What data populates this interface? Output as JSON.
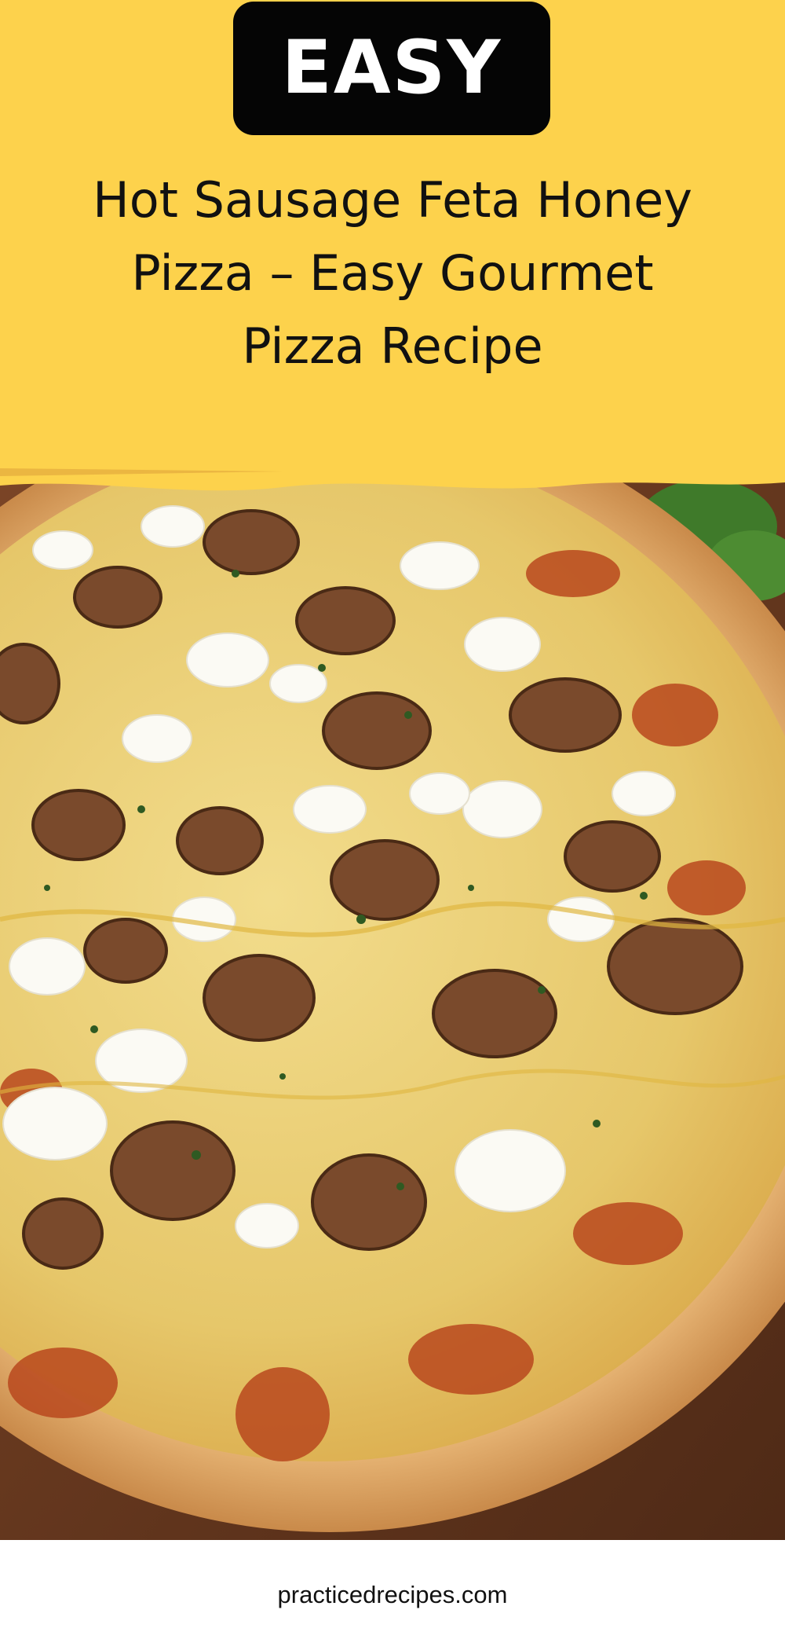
{
  "badge": {
    "label": "EASY"
  },
  "title": {
    "lines": [
      "Hot Sausage Feta Honey",
      "Pizza – Easy Gourmet",
      "Pizza Recipe"
    ]
  },
  "photo": {
    "subject": "pizza-photo"
  },
  "footer": {
    "site": "practicedrecipes.com"
  },
  "colors": {
    "header_bg": "#fdd24c",
    "badge_bg": "#050505",
    "badge_text": "#ffffff",
    "title_text": "#111111"
  }
}
